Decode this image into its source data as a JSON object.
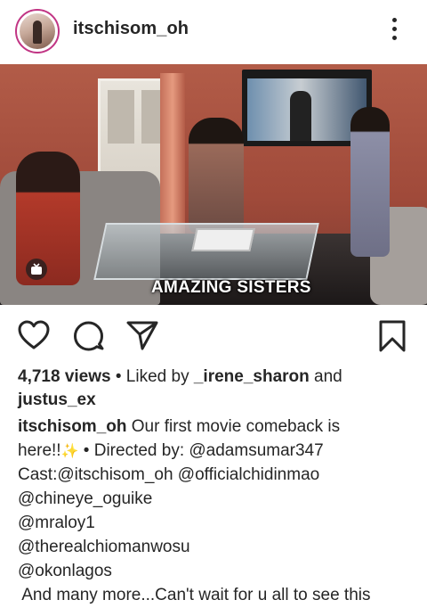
{
  "header": {
    "username": "itschisom_oh"
  },
  "media": {
    "caption_overlay": "AMAZING SISTERS"
  },
  "actions": {
    "icons": [
      "heart-icon",
      "comment-icon",
      "share-icon",
      "bookmark-icon"
    ]
  },
  "post": {
    "views": "4,718 views",
    "liked_by_prefix": "• Liked by",
    "liked_by_user": "_irene_sharon",
    "and": "and",
    "liked_by_user2": "justus_ex",
    "caption_username": "itschisom_oh",
    "caption_line1": "Our first movie comeback is",
    "caption_line2_a": "here!!",
    "caption_line2_sparkle": "✨",
    "caption_line2_b": "• Directed by: @adamsumar347",
    "caption_line3": "Cast:@itschisom_oh @officialchidinmao",
    "caption_line4": "@chineye_oguike",
    "caption_line5": "@mraloy1",
    "caption_line6": "@therealchiomanwosu",
    "caption_line7": "@okonlagos",
    "caption_line8": " And many more...Can't wait for u all to see this"
  }
}
